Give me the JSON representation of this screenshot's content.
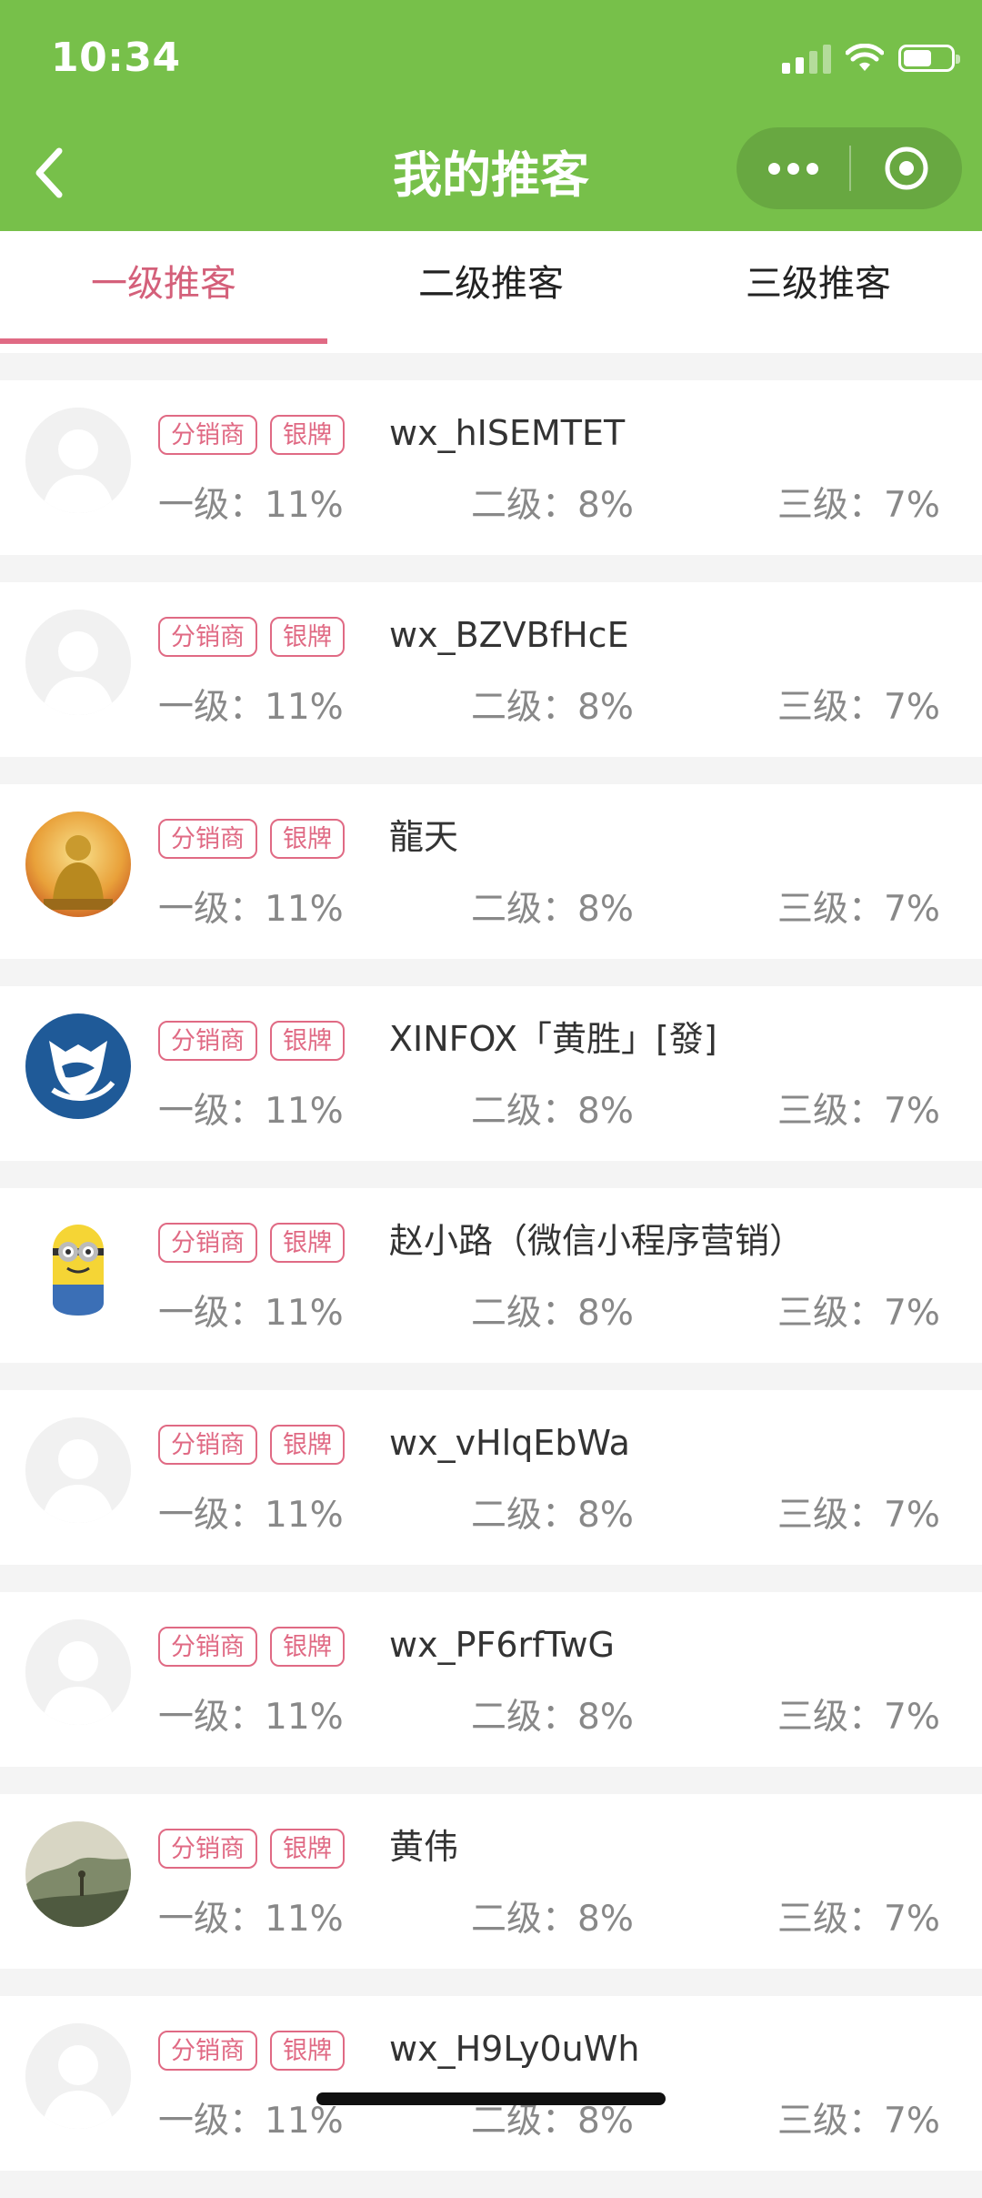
{
  "status_bar": {
    "time": "10:34"
  },
  "header": {
    "title": "我的推客"
  },
  "tabs": [
    {
      "label": "一级推客",
      "active": true
    },
    {
      "label": "二级推客",
      "active": false
    },
    {
      "label": "三级推客",
      "active": false
    }
  ],
  "colors": {
    "header_bg": "#77c04a",
    "accent": "#e06a84"
  },
  "list": {
    "items": [
      {
        "name": "wx_hISEMTET",
        "avatar": "default-avatar-icon",
        "badges": [
          "分销商",
          "银牌"
        ],
        "level1": "一级：11%",
        "level2": "二级：8%",
        "level3": "三级：7%"
      },
      {
        "name": "wx_BZVBfHcE",
        "avatar": "default-avatar-icon",
        "badges": [
          "分销商",
          "银牌"
        ],
        "level1": "一级：11%",
        "level2": "二级：8%",
        "level3": "三级：7%"
      },
      {
        "name": "龍天",
        "avatar": "buddha-avatar-icon",
        "badges": [
          "分销商",
          "银牌"
        ],
        "level1": "一级：11%",
        "level2": "二级：8%",
        "level3": "三级：7%"
      },
      {
        "name": "XINFOX「黄胜」[發]",
        "avatar": "fox-logo-avatar-icon",
        "badges": [
          "分销商",
          "银牌"
        ],
        "level1": "一级：11%",
        "level2": "二级：8%",
        "level3": "三级：7%"
      },
      {
        "name": "赵小路（微信小程序营销）",
        "avatar": "minion-avatar-icon",
        "badges": [
          "分销商",
          "银牌"
        ],
        "level1": "一级：11%",
        "level2": "二级：8%",
        "level3": "三级：7%"
      },
      {
        "name": "wx_vHlqEbWa",
        "avatar": "default-avatar-icon",
        "badges": [
          "分销商",
          "银牌"
        ],
        "level1": "一级：11%",
        "level2": "二级：8%",
        "level3": "三级：7%"
      },
      {
        "name": "wx_PF6rfTwG",
        "avatar": "default-avatar-icon",
        "badges": [
          "分销商",
          "银牌"
        ],
        "level1": "一级：11%",
        "level2": "二级：8%",
        "level3": "三级：7%"
      },
      {
        "name": "黄伟",
        "avatar": "landscape-avatar-icon",
        "badges": [
          "分销商",
          "银牌"
        ],
        "level1": "一级：11%",
        "level2": "二级：8%",
        "level3": "三级：7%"
      },
      {
        "name": "wx_H9Ly0uWh",
        "avatar": "default-avatar-icon",
        "badges": [
          "分销商",
          "银牌"
        ],
        "level1": "一级：11%",
        "level2": "二级：8%",
        "level3": "三级：7%"
      }
    ]
  }
}
